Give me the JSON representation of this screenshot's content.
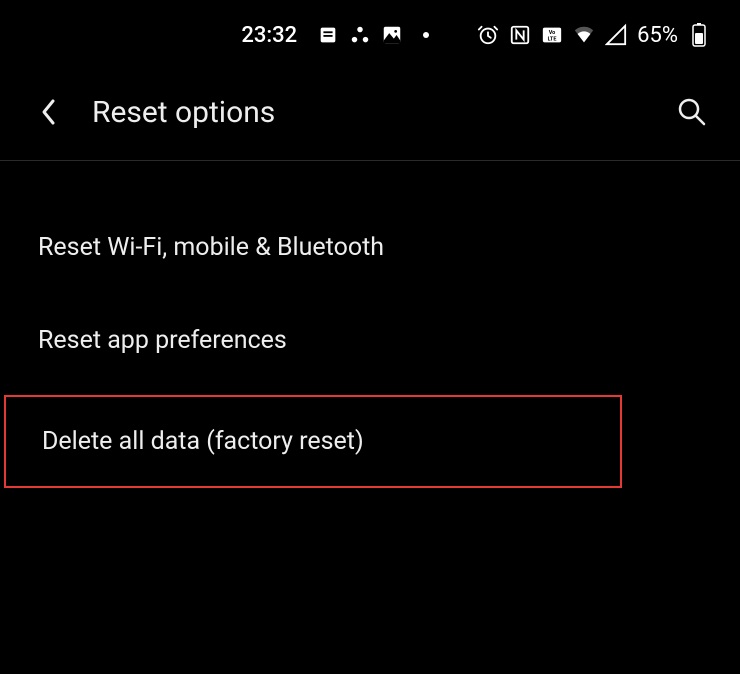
{
  "statusBar": {
    "time": "23:32",
    "batteryPercent": "65%"
  },
  "header": {
    "title": "Reset options"
  },
  "settings": {
    "items": [
      {
        "label": "Reset Wi-Fi, mobile & Bluetooth"
      },
      {
        "label": "Reset app preferences"
      },
      {
        "label": "Delete all data (factory reset)"
      }
    ]
  }
}
